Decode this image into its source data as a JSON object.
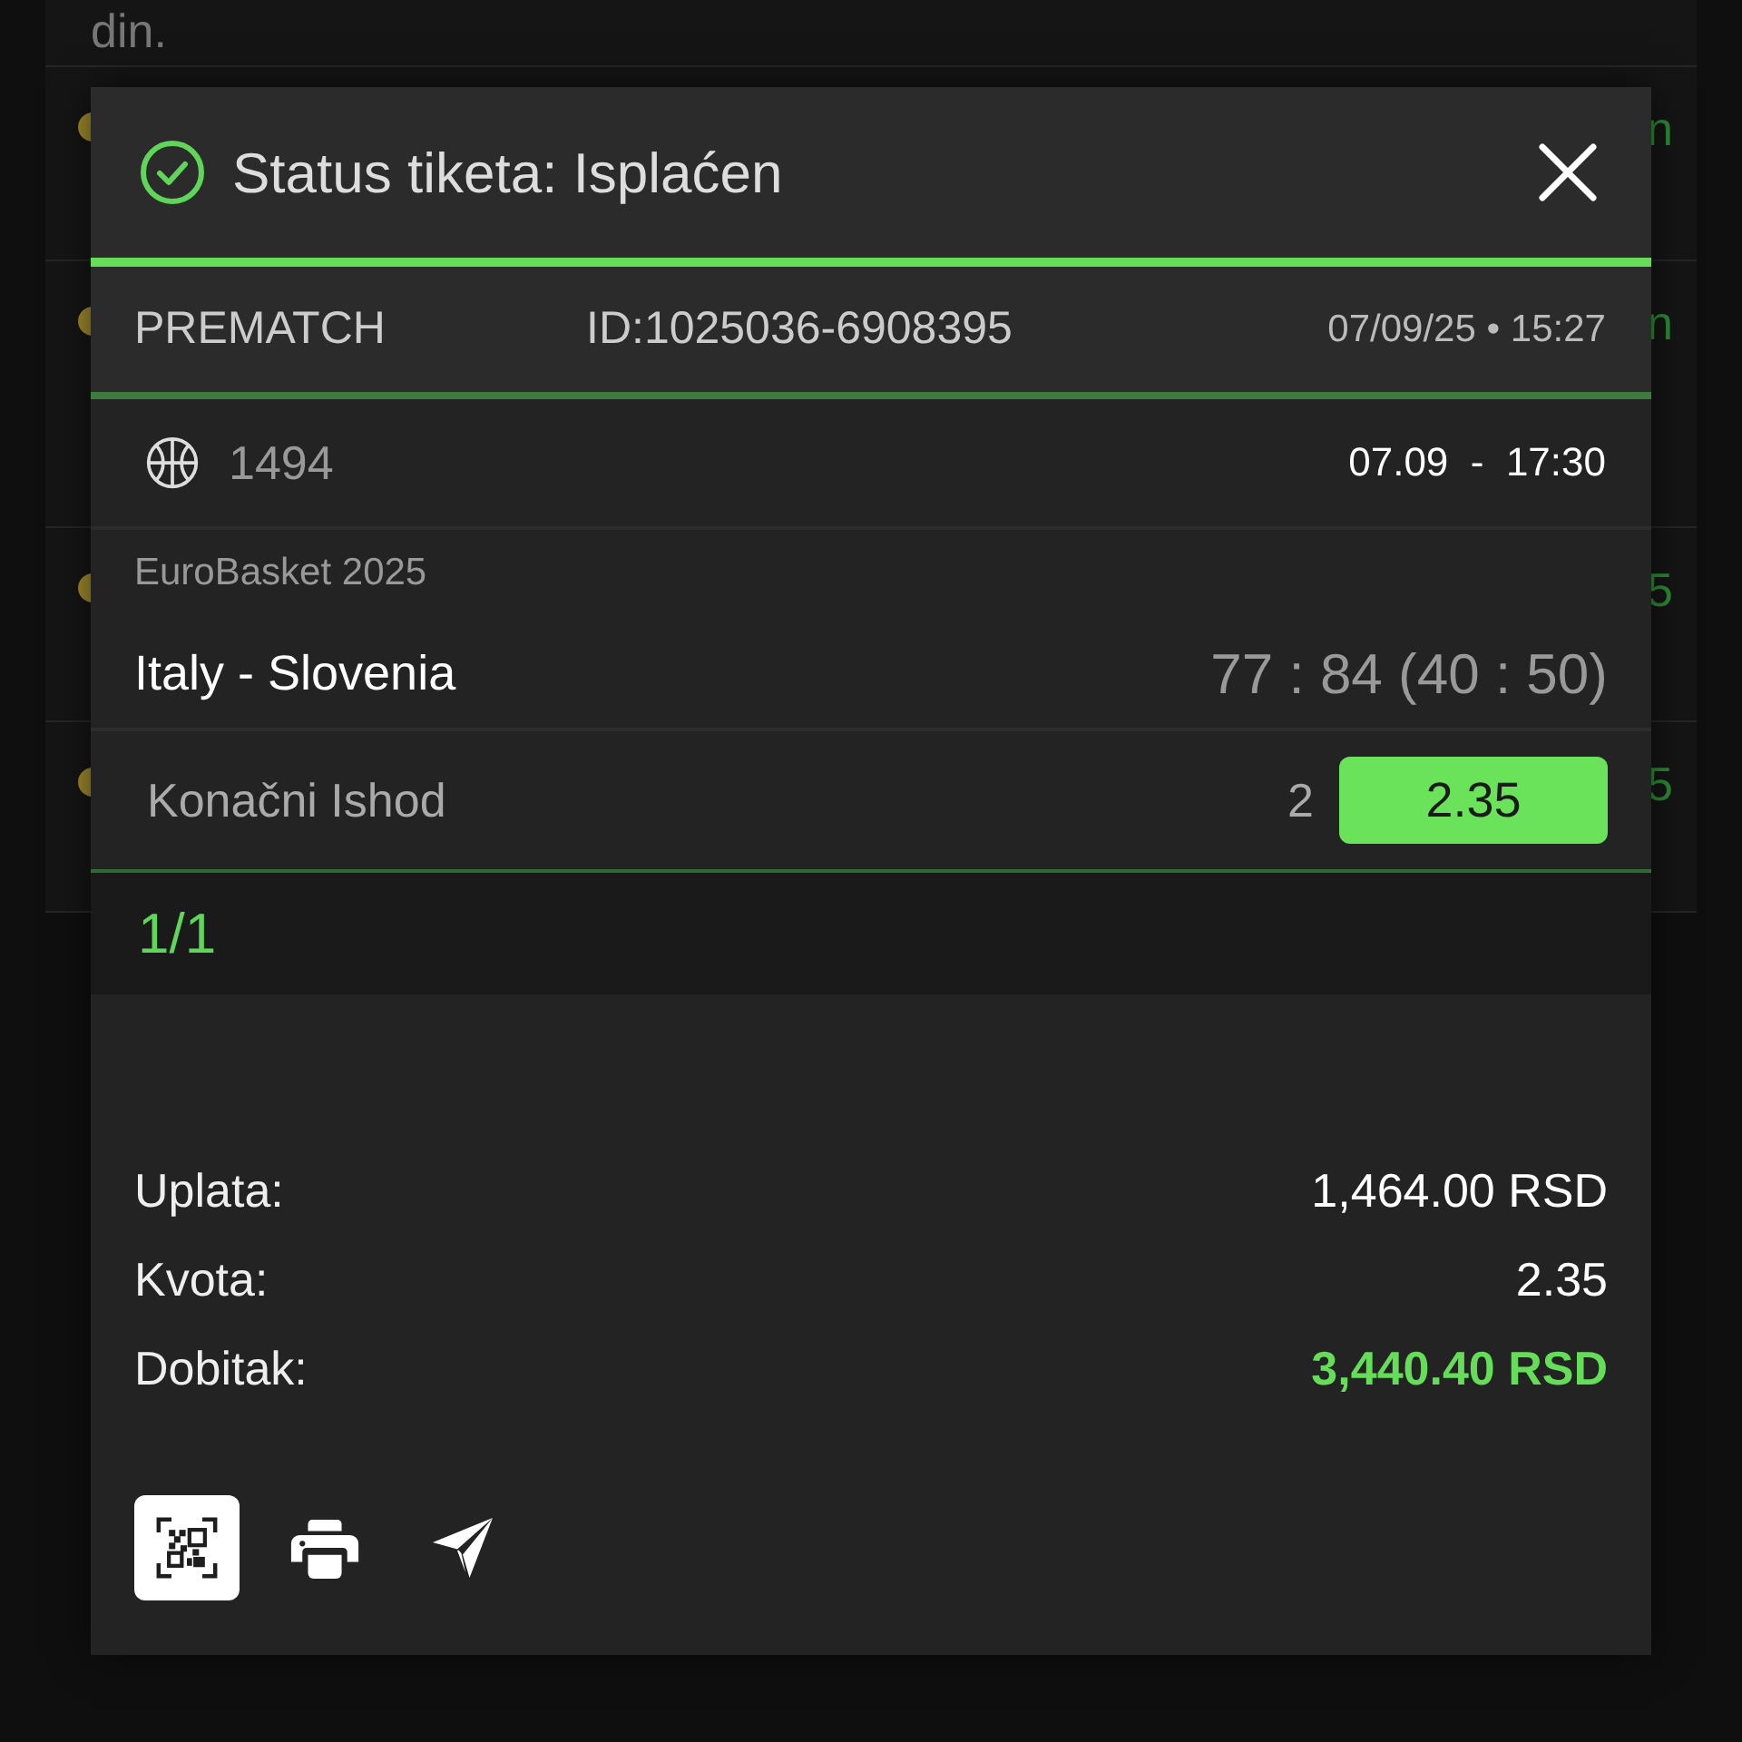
{
  "background_list": {
    "top_text": "din.",
    "rows": [
      {
        "trailing_text": "n"
      },
      {
        "trailing_text": "n"
      },
      {
        "trailing_text": "5"
      },
      {
        "trailing_text": "5"
      }
    ]
  },
  "ticket_modal": {
    "title": "Status tiketa: Isplaćen",
    "header": {
      "type": "PREMATCH",
      "id": "ID:1025036-6908395",
      "created": "07/09/25 • 15:27"
    },
    "events": [
      {
        "code": "1494",
        "start": "07.09  -  17:30",
        "league": "EuroBasket 2025",
        "match": "Italy - Slovenia",
        "score": "77 : 84 (40 : 50)",
        "market": "Konačni Ishod",
        "pick": "2",
        "odds": "2.35",
        "won": true
      }
    ],
    "counter": "1/1",
    "summary": [
      {
        "label": "Uplata:",
        "value": "1,464.00 RSD",
        "highlight": false
      },
      {
        "label": "Kvota:",
        "value": "2.35",
        "highlight": false
      },
      {
        "label": "Dobitak:",
        "value": "3,440.40 RSD",
        "highlight": true
      }
    ],
    "actions": [
      {
        "kind": "qr",
        "selected": true
      },
      {
        "kind": "print",
        "selected": false
      },
      {
        "kind": "send",
        "selected": false
      }
    ]
  }
}
